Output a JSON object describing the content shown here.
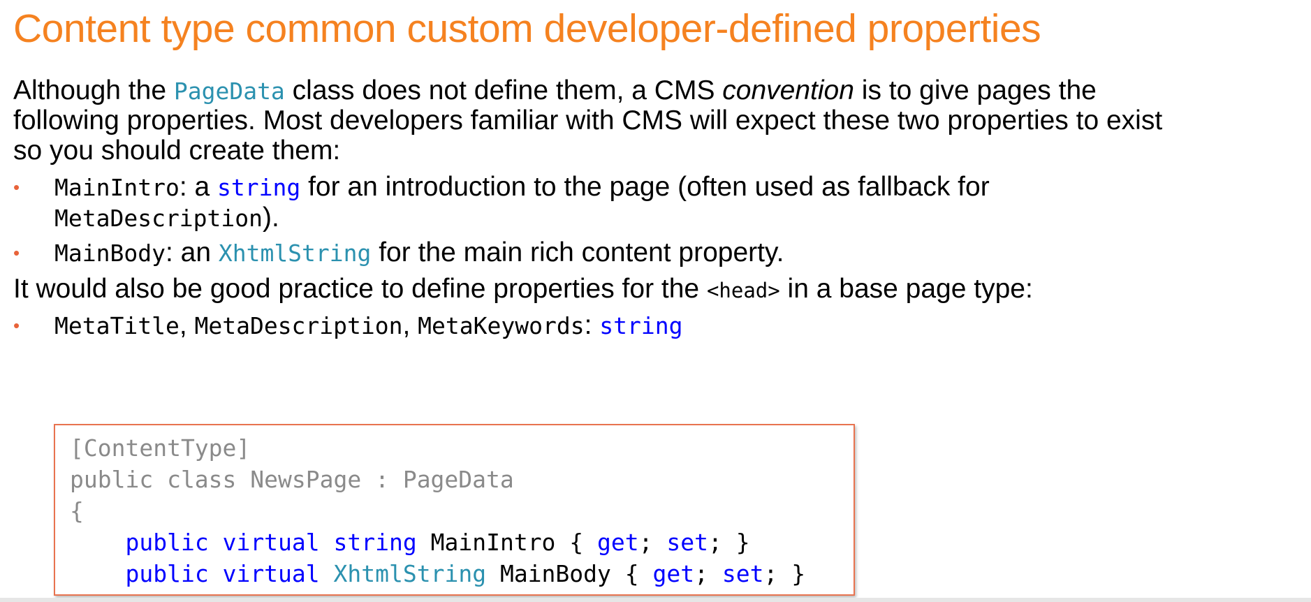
{
  "title": "Content type common custom developer-defined properties",
  "intro": {
    "part1": "Although the ",
    "code1": "PageData",
    "part2": " class does not define them, a CMS ",
    "emph": "convention",
    "part3": " is to give pages the",
    "line2": "following properties. Most developers familiar with CMS will expect these two properties to exist",
    "line3": "so you should create them:"
  },
  "bullets": [
    {
      "name": "MainIntro",
      "sep": ": a ",
      "type": "string",
      "rest": " for an introduction to the page (often used as fallback for",
      "cont_code": "MetaDescription",
      "cont_end": ")."
    },
    {
      "name": "MainBody",
      "sep": ": an ",
      "type": "XhtmlString",
      "rest": " for the main rich content property."
    }
  ],
  "second_para": {
    "part1": "It would also be good practice to define properties for the ",
    "code": "<head>",
    "part2": " in a base page type:"
  },
  "meta_bullet": {
    "p1": "MetaTitle",
    "c1": ", ",
    "p2": "MetaDescription",
    "c2": ", ",
    "p3": "MetaKeywords",
    "sep": ": ",
    "type": "string"
  },
  "code": {
    "line1": "[ContentType]",
    "line2": "public class NewsPage : PageData",
    "line3": "{",
    "line4": {
      "indent": "    ",
      "kw1": "public",
      "kw2": "virtual",
      "type": "string",
      "name": " MainIntro { ",
      "get": "get",
      "semi1": "; ",
      "set": "set",
      "end": "; }"
    },
    "line5": {
      "indent": "    ",
      "kw1": "public",
      "kw2": "virtual",
      "type": "XhtmlString",
      "name": " MainBody { ",
      "get": "get",
      "semi1": "; ",
      "set": "set",
      "end": "; }"
    }
  },
  "colors": {
    "title": "#f58220",
    "keyword": "#0000ff",
    "type": "#2b91af",
    "bullet": "#e8633a",
    "code_border": "#e8734f"
  }
}
